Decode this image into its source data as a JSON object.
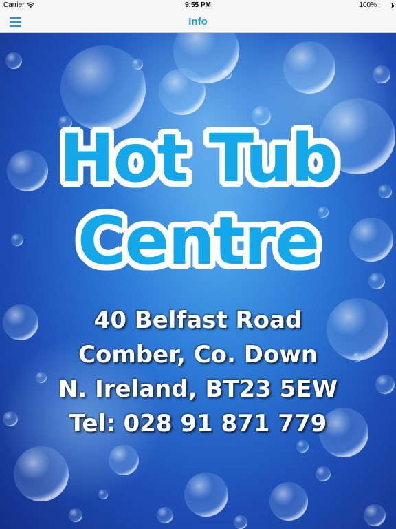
{
  "status_bar": {
    "carrier": "Carrier",
    "time": "9:55 PM",
    "battery": "100%"
  },
  "nav_bar": {
    "title": "Info",
    "menu_icon": "hamburger-menu-icon"
  },
  "content": {
    "logo": {
      "line1": "Hot Tub",
      "line2": "Centre"
    },
    "address": {
      "line1": "40 Belfast Road",
      "line2": "Comber, Co. Down",
      "line3": "N. Ireland, BT23 5EW",
      "phone": "Tel: 028 91 871 779"
    }
  },
  "colors": {
    "accent": "#1a9ad6",
    "logo_fill": "#14a7ea",
    "background_deep": "#142e88",
    "background_light": "#4fa9ec"
  }
}
